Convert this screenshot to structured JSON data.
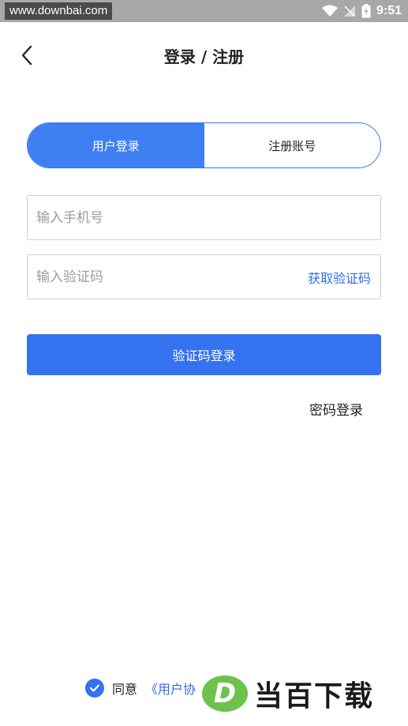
{
  "status_bar": {
    "watermark_url": "www.downbai.com",
    "time": "9:51"
  },
  "nav": {
    "title": "登录 / 注册",
    "back_icon": "chevron-left-icon"
  },
  "tabs": [
    {
      "label": "用户登录",
      "active": true
    },
    {
      "label": "注册账号",
      "active": false
    }
  ],
  "form": {
    "phone": {
      "placeholder": "输入手机号",
      "value": ""
    },
    "code": {
      "placeholder": "输入验证码",
      "value": "",
      "action_label": "获取验证码"
    },
    "submit_label": "验证码登录",
    "password_login_label": "密码登录"
  },
  "agreement": {
    "checked": true,
    "prefix": "同意",
    "link_label": "《用户协"
  },
  "watermark_logo": {
    "letter": "D",
    "text": "当百下载"
  },
  "colors": {
    "primary": "#3472ef",
    "link": "#2f6fde",
    "status_bar": "#a8a8a8"
  }
}
